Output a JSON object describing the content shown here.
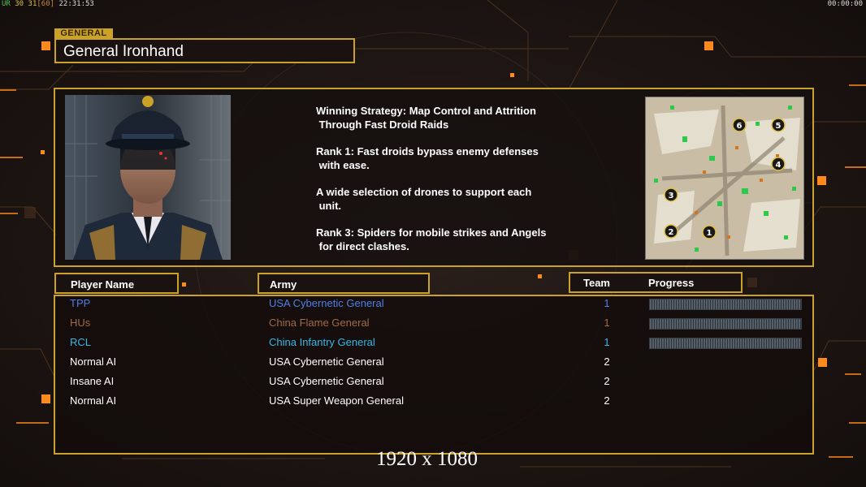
{
  "hud": {
    "left": {
      "part1": "UR",
      "part2": "30",
      "part3": "31",
      "part4": "[60]",
      "part5": "22:31:53"
    },
    "right": "00:00:00"
  },
  "general": {
    "tag": "GENERAL",
    "name": "General Ironhand"
  },
  "strategy": [
    "Winning Strategy: Map Control and Attrition\n Through Fast Droid Raids",
    "Rank 1: Fast droids bypass enemy defenses\n with ease.",
    "A wide selection of drones to support each\n unit.",
    "Rank 3: Spiders for mobile strikes and Angels\n for direct clashes."
  ],
  "minimap": {
    "start_positions": [
      "1",
      "2",
      "3",
      "4",
      "5",
      "6"
    ]
  },
  "table": {
    "headers": {
      "player": "Player Name",
      "army": "Army",
      "team": "Team",
      "progress": "Progress"
    },
    "rows": [
      {
        "name": "TPP",
        "army": "USA Cybernetic General",
        "team": "1",
        "color": "#4f7fe6",
        "progress": true
      },
      {
        "name": "HUs",
        "army": "China Flame General",
        "team": "1",
        "color": "#a36a45",
        "progress": true
      },
      {
        "name": "RCL",
        "army": "China Infantry General",
        "team": "1",
        "color": "#38b7e6",
        "progress": true
      },
      {
        "name": "Normal AI",
        "army": "USA Cybernetic General",
        "team": "2",
        "color": "#ffffff",
        "progress": false
      },
      {
        "name": "Insane AI",
        "army": "USA Cybernetic General",
        "team": "2",
        "color": "#ffffff",
        "progress": false
      },
      {
        "name": "Normal AI",
        "army": "USA Super Weapon General",
        "team": "2",
        "color": "#ffffff",
        "progress": false
      }
    ]
  },
  "resolution": "1920 x 1080",
  "colors": {
    "accent": "#c9a227",
    "orange": "#ff8a1c"
  }
}
